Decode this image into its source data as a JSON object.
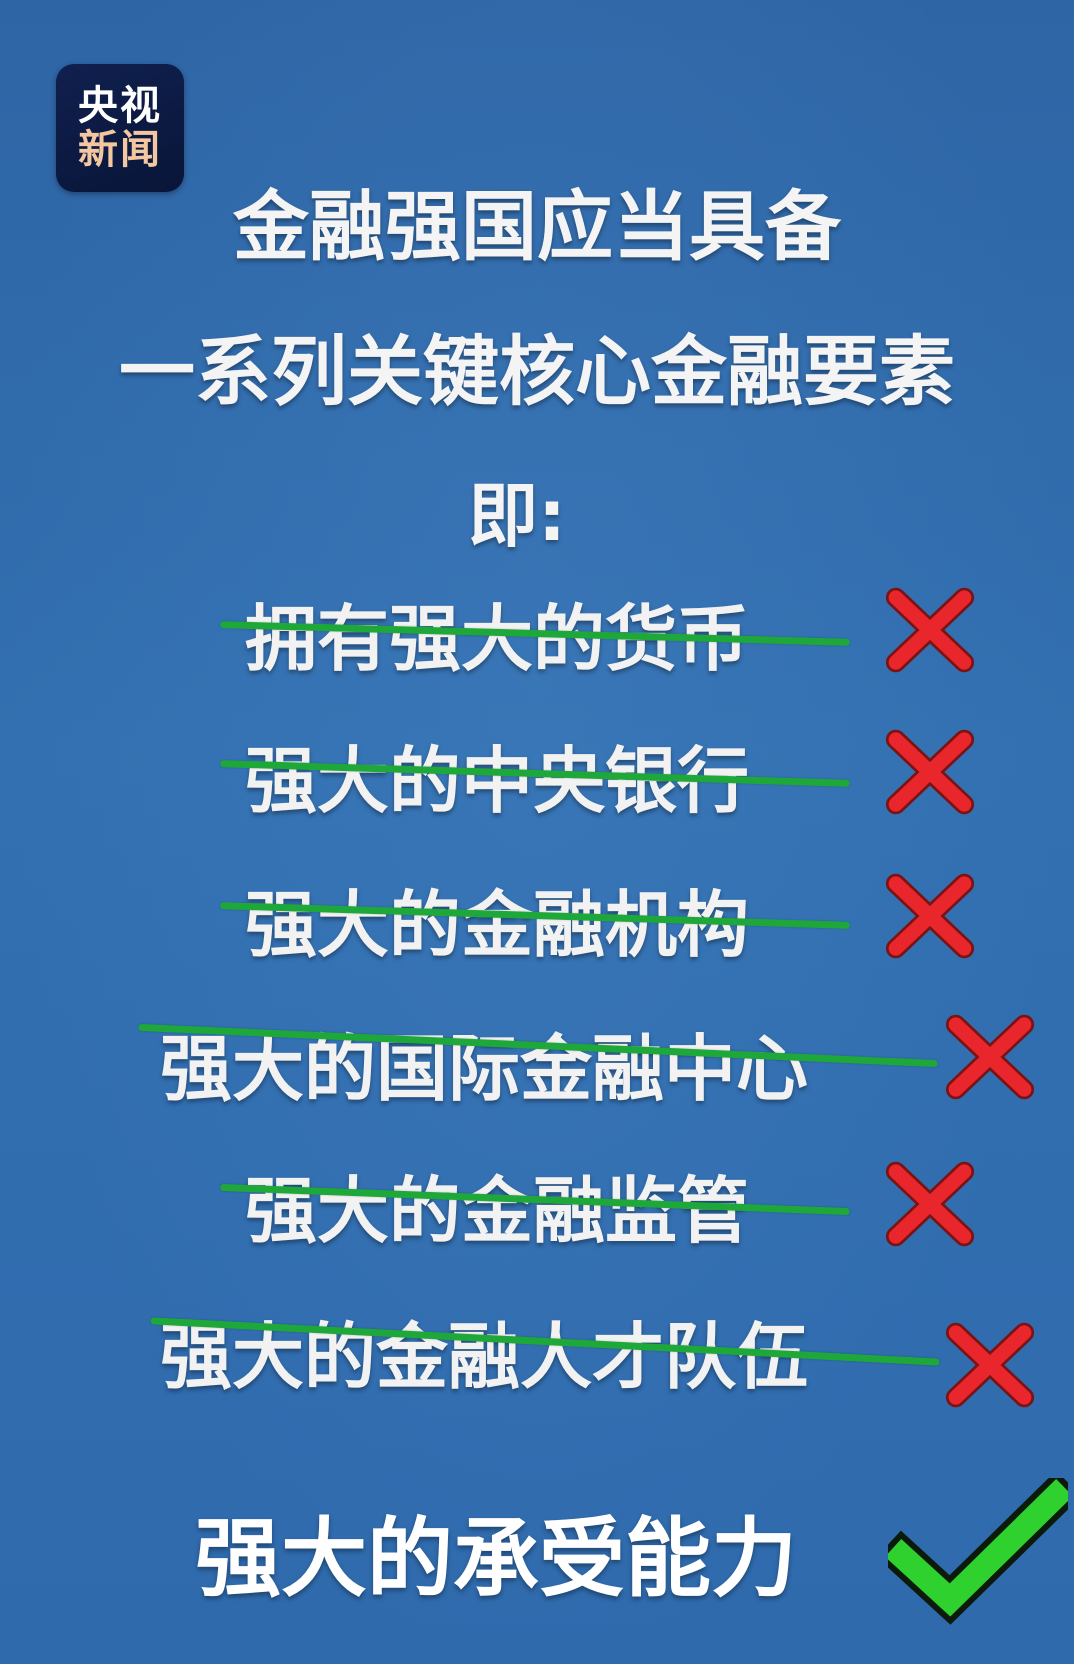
{
  "logo": {
    "line1": "央视",
    "line2": "新闻"
  },
  "heading": {
    "line1": "金融强国应当具备",
    "line2": "一系列关键核心金融要素",
    "line3": "即:"
  },
  "crossed_items": [
    {
      "text": "拥有强大的货币",
      "status_icon": "red-x-icon"
    },
    {
      "text": "强大的中央银行",
      "status_icon": "red-x-icon"
    },
    {
      "text": "强大的金融机构",
      "status_icon": "red-x-icon"
    },
    {
      "text": "强大的国际金融中心",
      "status_icon": "red-x-icon"
    },
    {
      "text": "强大的金融监管",
      "status_icon": "red-x-icon"
    },
    {
      "text": "强大的金融人才队伍",
      "status_icon": "red-x-icon"
    }
  ],
  "answer": {
    "text": "强大的承受能力",
    "status_icon": "green-check-icon"
  },
  "colors": {
    "background": "#2f6aaa",
    "strike_line": "#1fa83a",
    "cross": "#e8262b",
    "check": "#2fd12f"
  }
}
